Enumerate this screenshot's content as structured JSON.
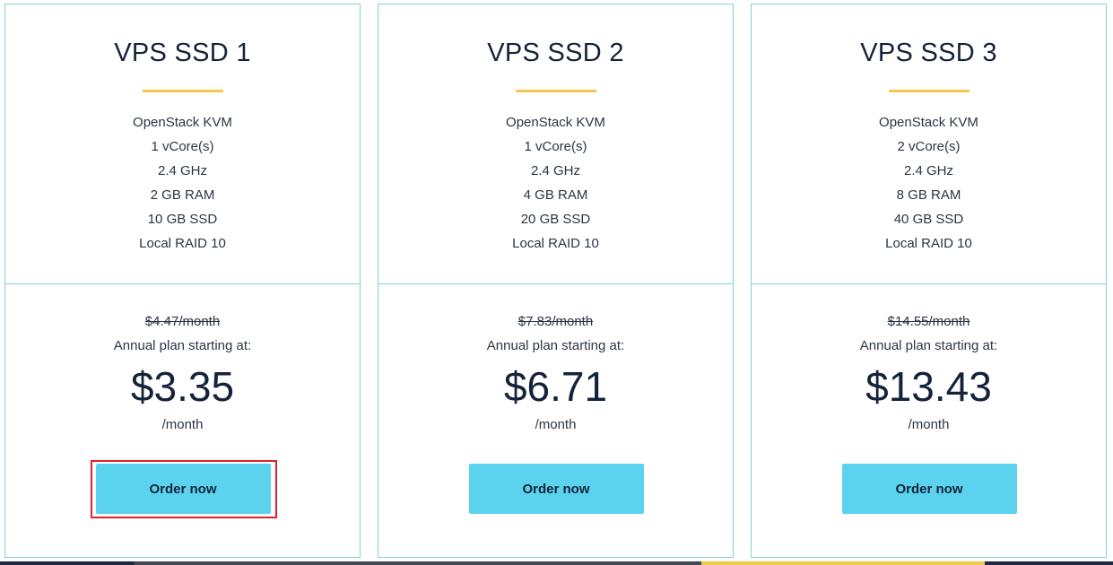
{
  "colors": {
    "card_border": "#7fd0de",
    "accent_bar": "#f2c94c",
    "button_bg": "#5bd3ee",
    "highlight": "#e0202a",
    "strip_dark": "#1b2a3e",
    "strip_gray": "#3f4a57",
    "strip_yellow": "#f2c94c"
  },
  "plans": [
    {
      "name": "VPS SSD 1",
      "features": [
        "OpenStack KVM",
        "1 vCore(s)",
        "2.4 GHz",
        "2 GB RAM",
        "10 GB SSD",
        "Local RAID 10"
      ],
      "old_price": "$4.47/month",
      "annual_label": "Annual plan starting at:",
      "price": "$3.35",
      "per_month": "/month",
      "button_label": "Order now"
    },
    {
      "name": "VPS SSD 2",
      "features": [
        "OpenStack KVM",
        "1 vCore(s)",
        "2.4 GHz",
        "4 GB RAM",
        "20 GB SSD",
        "Local RAID 10"
      ],
      "old_price": "$7.83/month",
      "annual_label": "Annual plan starting at:",
      "price": "$6.71",
      "per_month": "/month",
      "button_label": "Order now"
    },
    {
      "name": "VPS SSD 3",
      "features": [
        "OpenStack KVM",
        "2 vCore(s)",
        "2.4 GHz",
        "8 GB RAM",
        "40 GB SSD",
        "Local RAID 10"
      ],
      "old_price": "$14.55/month",
      "annual_label": "Annual plan starting at:",
      "price": "$13.43",
      "per_month": "/month",
      "button_label": "Order now"
    }
  ]
}
